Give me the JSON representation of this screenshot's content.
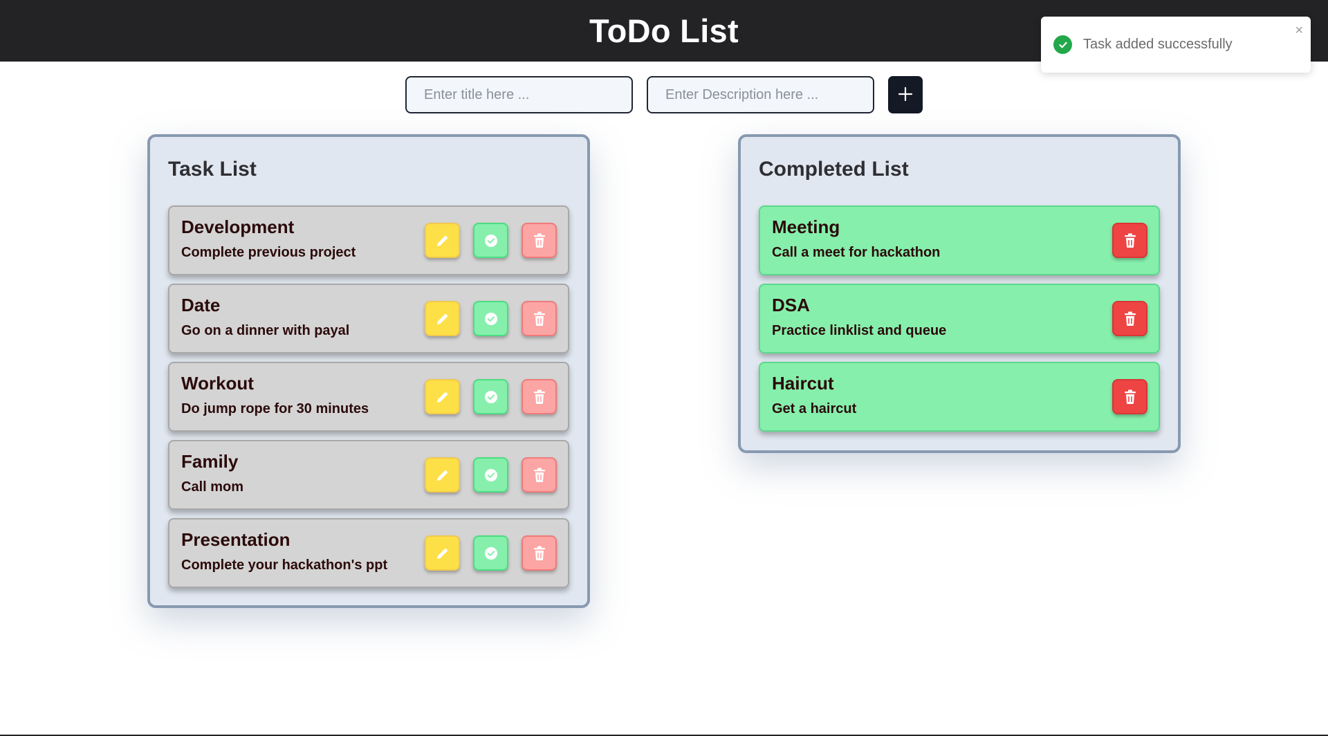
{
  "header": {
    "title": "ToDo List"
  },
  "toast": {
    "message": "Task added successfully",
    "close": "×"
  },
  "form": {
    "title_placeholder": "Enter title here ...",
    "description_placeholder": "Enter Description here ...",
    "title_value": "",
    "description_value": ""
  },
  "task_list": {
    "heading": "Task List",
    "items": [
      {
        "title": "Development",
        "description": "Complete previous project"
      },
      {
        "title": "Date",
        "description": "Go on a dinner with payal"
      },
      {
        "title": "Workout",
        "description": "Do jump rope for 30 minutes"
      },
      {
        "title": "Family",
        "description": "Call mom"
      },
      {
        "title": "Presentation",
        "description": "Complete your hackathon's ppt"
      }
    ]
  },
  "completed_list": {
    "heading": "Completed List",
    "items": [
      {
        "title": "Meeting",
        "description": "Call a meet for hackathon"
      },
      {
        "title": "DSA",
        "description": "Practice linklist and queue"
      },
      {
        "title": "Haircut",
        "description": "Get a haircut"
      }
    ]
  },
  "icons": {
    "add": "plus-icon",
    "edit": "pencil-icon",
    "complete": "check-circle-icon",
    "delete": "trash-icon",
    "toast": "check-circle-icon"
  },
  "colors": {
    "header_bg": "#232326",
    "panel_bg": "#e1e7f0",
    "task_card": "#d4d4d4",
    "done_card": "#86efac",
    "edit": "#fde047",
    "complete": "#86efac",
    "delete": "#ef4444",
    "delete_soft": "#fca5a5",
    "toast_success": "#22a84a"
  }
}
